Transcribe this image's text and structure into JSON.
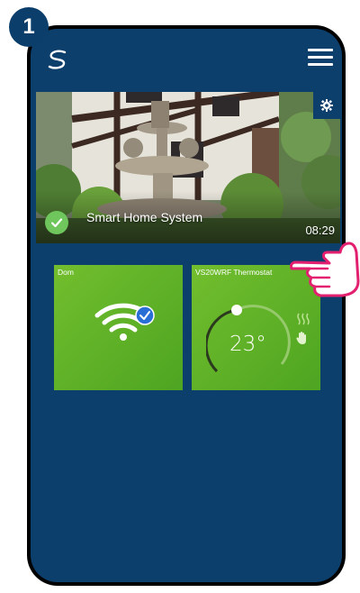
{
  "step": {
    "number": "1"
  },
  "app": {
    "logo_icon": "salus-s-logo-icon",
    "menu_icon": "hamburger-menu-icon"
  },
  "banner": {
    "title": "Smart Home System",
    "time": "08:29",
    "settings_icon": "gear-icon",
    "status_icon": "check-icon"
  },
  "tiles": [
    {
      "label": "Dom",
      "icon": "wifi-icon",
      "status_icon": "check-icon"
    },
    {
      "label": "VS20WRF Thermostat",
      "temperature": "23°",
      "mode_icons": [
        "heating-icon",
        "manual-hand-icon"
      ]
    }
  ],
  "colors": {
    "screen_bg": "#0d3f6d",
    "tile_green": "#5fb229",
    "check_green": "#6ec65c",
    "badge_blue": "#0b3e6b"
  }
}
